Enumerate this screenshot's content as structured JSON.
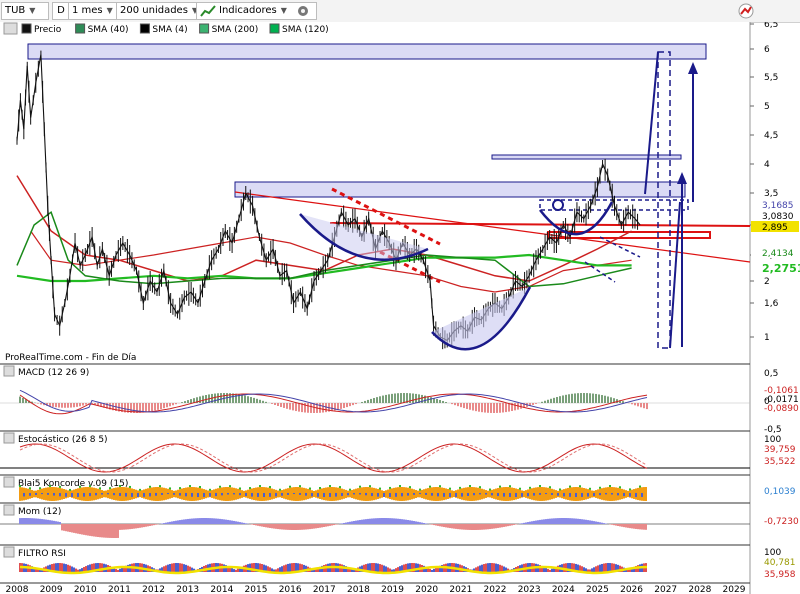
{
  "toolbar": {
    "symbol": "TUB",
    "period_icon": "D",
    "period": "1 mes",
    "units": "200 unidades",
    "indicators": "Indicadores",
    "trend_icon_name": "chart-line-icon",
    "settings_icon_name": "gear-icon"
  },
  "legend": [
    {
      "label": "Precio",
      "color": "#111111"
    },
    {
      "label": "SMA (40)",
      "color": "#2e8b57"
    },
    {
      "label": "SMA (4)",
      "color": "#000000"
    },
    {
      "label": "SMA (200)",
      "color": "#3cb371"
    },
    {
      "label": "SMA (120)",
      "color": "#00b050"
    }
  ],
  "watermark": "ProRealTime.com - Fin de Día",
  "colors": {
    "price": "#111111",
    "sma_red": "#cc2222",
    "sma_green": "#22bb22",
    "sma_dark_green": "#1a8a1a",
    "annotation_blue": "#1a1a8a",
    "zone_fill": "#c8c8f0",
    "support_red": "#dd1111",
    "rsi_yellow": "#f2e200",
    "konkorde_orange": "#f39c12",
    "konkorde_blue": "#4a5fd0",
    "konkorde_green": "#2db82d",
    "hist_red": "#e88a8a",
    "hist_blue": "#8a8ae8"
  },
  "x_axis": {
    "labels": [
      "2008",
      "2009",
      "2010",
      "2011",
      "2012",
      "2013",
      "2014",
      "2015",
      "2016",
      "2017",
      "2018",
      "2019",
      "2020",
      "2021",
      "2022",
      "2023",
      "2024",
      "2025",
      "2026",
      "2027",
      "2028",
      "2029"
    ]
  },
  "panels": {
    "price": {
      "ticks": [
        "6,5",
        "6",
        "5,5",
        "5",
        "4,5",
        "4",
        "3,5",
        "3",
        "2,5",
        "2",
        "1,6",
        "1"
      ],
      "labels": [
        {
          "text": "3,1685",
          "bg": "#ffffff",
          "fg": "#4444aa"
        },
        {
          "text": "3,0830",
          "bg": "#ffffff",
          "fg": "#000000"
        },
        {
          "text": "2,895",
          "bg": "#f2e200",
          "fg": "#000000"
        },
        {
          "text": "2,4134",
          "bg": "#ffffff",
          "fg": "#1a8a1a"
        },
        {
          "text": "2,2751",
          "bg": "#ffffff",
          "fg": "#22bb22"
        }
      ]
    },
    "macd": {
      "title": "MACD (12 26 9)",
      "ticks": [
        "0,5",
        "0",
        "-0,5"
      ],
      "labels": [
        {
          "text": "-0,1061",
          "fg": "#cc2222"
        },
        {
          "text": "-0,0171",
          "fg": "#000000"
        },
        {
          "text": "-0,0890",
          "fg": "#cc2222"
        }
      ]
    },
    "stoch": {
      "title": "Estocástico (26 8 5)",
      "ticks": [
        "100"
      ],
      "labels": [
        {
          "text": "39,759",
          "fg": "#cc2222"
        },
        {
          "text": "35,522",
          "fg": "#cc2222"
        }
      ]
    },
    "konkorde": {
      "title": "Blai5 Koncorde v.09 (15)",
      "labels": [
        {
          "text": "0,1039",
          "fg": "#2b7fd0"
        }
      ]
    },
    "mom": {
      "title": "Mom (12)",
      "labels": [
        {
          "text": "-0,7230",
          "fg": "#cc2222"
        }
      ]
    },
    "rsi": {
      "title": "FILTRO RSI",
      "ticks": [
        "100"
      ],
      "labels": [
        {
          "text": "40,781",
          "fg": "#999900"
        },
        {
          "text": "35,958",
          "fg": "#cc2222"
        }
      ]
    }
  },
  "chart_data": {
    "type": "line",
    "title": "TUB",
    "x_range": [
      2008,
      2029
    ],
    "y_range": [
      0.9,
      6.5
    ],
    "price_path": [
      [
        2008.0,
        4.4
      ],
      [
        2008.1,
        5.1
      ],
      [
        2008.2,
        4.6
      ],
      [
        2008.3,
        5.7
      ],
      [
        2008.4,
        4.8
      ],
      [
        2008.55,
        5.4
      ],
      [
        2008.7,
        5.9
      ],
      [
        2008.8,
        4.6
      ],
      [
        2008.9,
        3.3
      ],
      [
        2009.0,
        2.4
      ],
      [
        2009.1,
        1.4
      ],
      [
        2009.25,
        1.2
      ],
      [
        2009.4,
        1.6
      ],
      [
        2009.55,
        2.1
      ],
      [
        2009.7,
        2.7
      ],
      [
        2009.85,
        2.3
      ],
      [
        2010.0,
        2.5
      ],
      [
        2010.2,
        2.8
      ],
      [
        2010.35,
        2.3
      ],
      [
        2010.5,
        2.6
      ],
      [
        2010.7,
        2.1
      ],
      [
        2010.9,
        2.5
      ],
      [
        2011.1,
        2.7
      ],
      [
        2011.3,
        2.5
      ],
      [
        2011.5,
        2.2
      ],
      [
        2011.7,
        1.6
      ],
      [
        2011.9,
        2.0
      ],
      [
        2012.1,
        1.8
      ],
      [
        2012.3,
        2.2
      ],
      [
        2012.5,
        1.6
      ],
      [
        2012.7,
        1.4
      ],
      [
        2012.9,
        1.7
      ],
      [
        2013.1,
        1.8
      ],
      [
        2013.3,
        1.6
      ],
      [
        2013.5,
        2.0
      ],
      [
        2013.7,
        2.4
      ],
      [
        2013.9,
        2.6
      ],
      [
        2014.1,
        2.9
      ],
      [
        2014.3,
        2.7
      ],
      [
        2014.5,
        3.1
      ],
      [
        2014.7,
        3.5
      ],
      [
        2014.9,
        3.3
      ],
      [
        2015.1,
        2.8
      ],
      [
        2015.3,
        2.4
      ],
      [
        2015.5,
        2.6
      ],
      [
        2015.7,
        2.1
      ],
      [
        2015.9,
        2.2
      ],
      [
        2016.1,
        1.6
      ],
      [
        2016.3,
        1.8
      ],
      [
        2016.5,
        1.5
      ],
      [
        2016.7,
        2.0
      ],
      [
        2016.9,
        2.2
      ],
      [
        2017.1,
        2.4
      ],
      [
        2017.3,
        2.8
      ],
      [
        2017.5,
        3.2
      ],
      [
        2017.7,
        3.0
      ],
      [
        2017.9,
        3.1
      ],
      [
        2018.1,
        2.8
      ],
      [
        2018.3,
        3.1
      ],
      [
        2018.5,
        2.6
      ],
      [
        2018.7,
        2.9
      ],
      [
        2018.9,
        2.7
      ],
      [
        2019.1,
        2.4
      ],
      [
        2019.3,
        2.7
      ],
      [
        2019.5,
        2.5
      ],
      [
        2019.7,
        2.6
      ],
      [
        2019.9,
        2.4
      ],
      [
        2020.1,
        2.0
      ],
      [
        2020.2,
        1.2
      ],
      [
        2020.4,
        1.0
      ],
      [
        2020.6,
        0.95
      ],
      [
        2020.8,
        1.1
      ],
      [
        2021.0,
        1.2
      ],
      [
        2021.2,
        1.1
      ],
      [
        2021.4,
        1.35
      ],
      [
        2021.6,
        1.3
      ],
      [
        2021.8,
        1.5
      ],
      [
        2022.0,
        1.6
      ],
      [
        2022.2,
        1.5
      ],
      [
        2022.4,
        1.7
      ],
      [
        2022.6,
        2.0
      ],
      [
        2022.8,
        1.9
      ],
      [
        2023.0,
        2.1
      ],
      [
        2023.2,
        2.4
      ],
      [
        2023.4,
        2.6
      ],
      [
        2023.6,
        2.8
      ],
      [
        2023.8,
        2.7
      ],
      [
        2024.0,
        3.0
      ],
      [
        2024.2,
        2.8
      ],
      [
        2024.4,
        3.2
      ],
      [
        2024.6,
        3.1
      ],
      [
        2024.8,
        3.3
      ],
      [
        2025.0,
        3.6
      ],
      [
        2025.15,
        4.0
      ],
      [
        2025.3,
        3.8
      ],
      [
        2025.5,
        3.3
      ],
      [
        2025.7,
        3.0
      ],
      [
        2025.9,
        3.2
      ],
      [
        2026.1,
        3.1
      ],
      [
        2026.25,
        3.0
      ]
    ],
    "series": [
      {
        "values": [
          [
            2008,
            3.8
          ],
          [
            2009,
            2.9
          ],
          [
            2010,
            2.5
          ],
          [
            2011,
            2.4
          ],
          [
            2012,
            2.2
          ],
          [
            2013,
            2.0
          ],
          [
            2014,
            2.1
          ],
          [
            2015,
            2.4
          ],
          [
            2016,
            2.3
          ],
          [
            2017,
            2.2
          ],
          [
            2018,
            2.5
          ],
          [
            2019,
            2.6
          ],
          [
            2020,
            2.5
          ],
          [
            2021,
            2.3
          ],
          [
            2022,
            2.1
          ],
          [
            2023,
            2.0
          ],
          [
            2024,
            2.3
          ],
          [
            2025,
            2.6
          ],
          [
            2026,
            2.9
          ]
        ]
      },
      {
        "values": [
          [
            2008.4,
            2.9
          ],
          [
            2009,
            2.4
          ],
          [
            2010,
            2.3
          ],
          [
            2011,
            2.4
          ],
          [
            2012,
            2.5
          ],
          [
            2013,
            2.6
          ],
          [
            2014,
            2.7
          ],
          [
            2015,
            2.8
          ],
          [
            2016,
            2.7
          ],
          [
            2017,
            2.5
          ],
          [
            2018,
            2.3
          ],
          [
            2019,
            2.2
          ],
          [
            2020,
            2.1
          ],
          [
            2021,
            1.9
          ],
          [
            2022,
            1.8
          ],
          [
            2023,
            1.9
          ],
          [
            2024,
            2.2
          ],
          [
            2025,
            2.3
          ],
          [
            2026,
            2.4
          ]
        ]
      },
      {
        "values": [
          [
            2008,
            2.1
          ],
          [
            2009,
            2.0
          ],
          [
            2010,
            2.0
          ],
          [
            2011,
            2.05
          ],
          [
            2012,
            2.1
          ],
          [
            2013,
            2.05
          ],
          [
            2014,
            2.1
          ],
          [
            2015,
            2.05
          ],
          [
            2016,
            2.05
          ],
          [
            2017,
            2.15
          ],
          [
            2018,
            2.25
          ],
          [
            2019,
            2.35
          ],
          [
            2020,
            2.45
          ],
          [
            2021,
            2.45
          ],
          [
            2022,
            2.45
          ],
          [
            2023,
            2.5
          ],
          [
            2024,
            2.4
          ],
          [
            2025,
            2.3
          ],
          [
            2026,
            2.3
          ]
        ]
      },
      {
        "values": [
          [
            2008,
            2.3
          ],
          [
            2008.5,
            3.0
          ],
          [
            2009,
            3.2
          ],
          [
            2009.5,
            2.4
          ],
          [
            2010,
            2.1
          ],
          [
            2011,
            2.0
          ],
          [
            2012,
            1.95
          ],
          [
            2013,
            2.0
          ],
          [
            2014,
            2.05
          ],
          [
            2015,
            2.05
          ],
          [
            2016,
            2.05
          ],
          [
            2017,
            2.2
          ],
          [
            2018,
            2.3
          ],
          [
            2019,
            2.4
          ],
          [
            2020,
            2.5
          ],
          [
            2021,
            2.45
          ],
          [
            2022,
            2.4
          ],
          [
            2023,
            1.9
          ],
          [
            2024,
            1.95
          ],
          [
            2025,
            2.1
          ],
          [
            2026,
            2.25
          ]
        ]
      }
    ]
  }
}
